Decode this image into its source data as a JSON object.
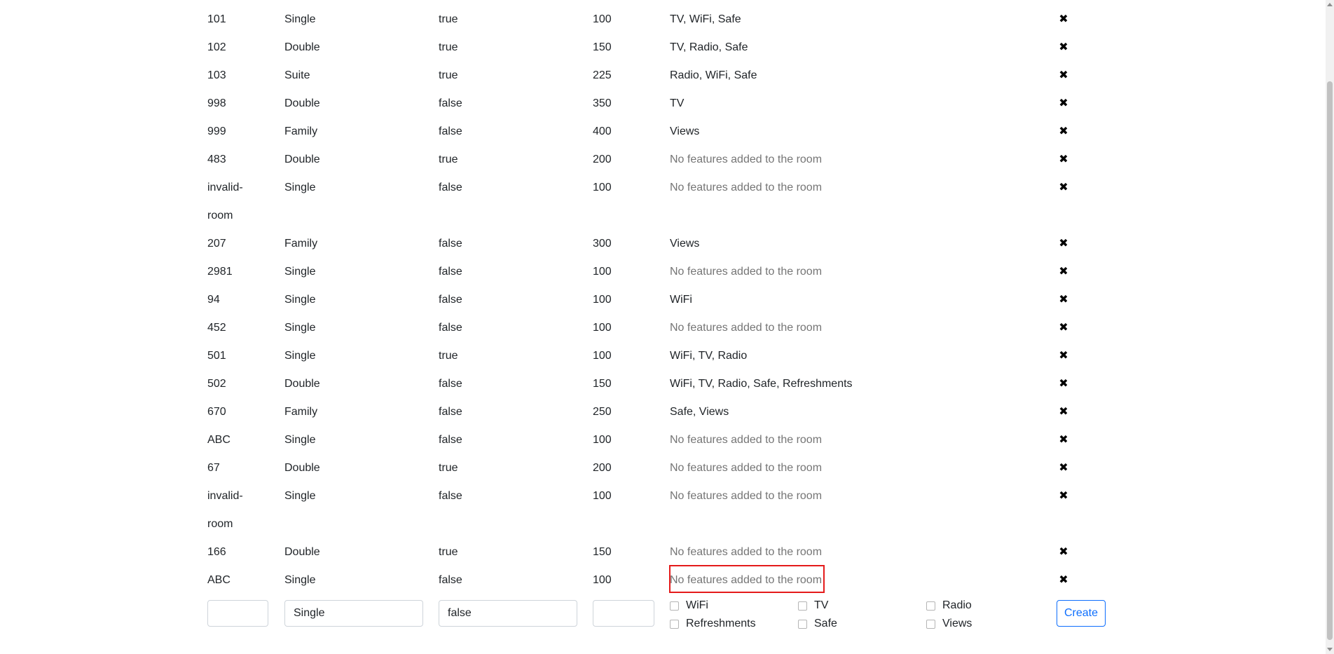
{
  "rooms": [
    {
      "number": "101",
      "type": "Single",
      "accessible": "true",
      "price": "100",
      "features": "TV, WiFi, Safe",
      "empty": false
    },
    {
      "number": "102",
      "type": "Double",
      "accessible": "true",
      "price": "150",
      "features": "TV, Radio, Safe",
      "empty": false
    },
    {
      "number": "103",
      "type": "Suite",
      "accessible": "true",
      "price": "225",
      "features": "Radio, WiFi, Safe",
      "empty": false
    },
    {
      "number": "998",
      "type": "Double",
      "accessible": "false",
      "price": "350",
      "features": "TV",
      "empty": false
    },
    {
      "number": "999",
      "type": "Family",
      "accessible": "false",
      "price": "400",
      "features": "Views",
      "empty": false
    },
    {
      "number": "483",
      "type": "Double",
      "accessible": "true",
      "price": "200",
      "features": "No features added to the room",
      "empty": true
    },
    {
      "number": "invalid-room",
      "type": "Single",
      "accessible": "false",
      "price": "100",
      "features": "No features added to the room",
      "empty": true
    },
    {
      "number": "207",
      "type": "Family",
      "accessible": "false",
      "price": "300",
      "features": "Views",
      "empty": false
    },
    {
      "number": "2981",
      "type": "Single",
      "accessible": "false",
      "price": "100",
      "features": "No features added to the room",
      "empty": true
    },
    {
      "number": "94",
      "type": "Single",
      "accessible": "false",
      "price": "100",
      "features": "WiFi",
      "empty": false
    },
    {
      "number": "452",
      "type": "Single",
      "accessible": "false",
      "price": "100",
      "features": "No features added to the room",
      "empty": true
    },
    {
      "number": "501",
      "type": "Single",
      "accessible": "true",
      "price": "100",
      "features": "WiFi, TV, Radio",
      "empty": false
    },
    {
      "number": "502",
      "type": "Double",
      "accessible": "false",
      "price": "150",
      "features": "WiFi, TV, Radio, Safe, Refreshments",
      "empty": false
    },
    {
      "number": "670",
      "type": "Family",
      "accessible": "false",
      "price": "250",
      "features": "Safe, Views",
      "empty": false
    },
    {
      "number": "ABC",
      "type": "Single",
      "accessible": "false",
      "price": "100",
      "features": "No features added to the room",
      "empty": true
    },
    {
      "number": "67",
      "type": "Double",
      "accessible": "true",
      "price": "200",
      "features": "No features added to the room",
      "empty": true
    },
    {
      "number": "invalid-room",
      "type": "Single",
      "accessible": "false",
      "price": "100",
      "features": "No features added to the room",
      "empty": true
    },
    {
      "number": "166",
      "type": "Double",
      "accessible": "true",
      "price": "150",
      "features": "No features added to the room",
      "empty": true
    },
    {
      "number": "ABC",
      "type": "Single",
      "accessible": "false",
      "price": "100",
      "features": "No features added to the room",
      "empty": true
    }
  ],
  "delete_glyph": "✖",
  "form": {
    "room_number_value": "",
    "type_value": "Single",
    "accessible_value": "false",
    "price_value": "",
    "features": [
      "WiFi",
      "TV",
      "Radio",
      "Refreshments",
      "Safe",
      "Views"
    ],
    "create_label": "Create"
  },
  "colors": {
    "highlight": "#e41b1b",
    "button": "#0d6efd",
    "muted_text": "#757575"
  }
}
